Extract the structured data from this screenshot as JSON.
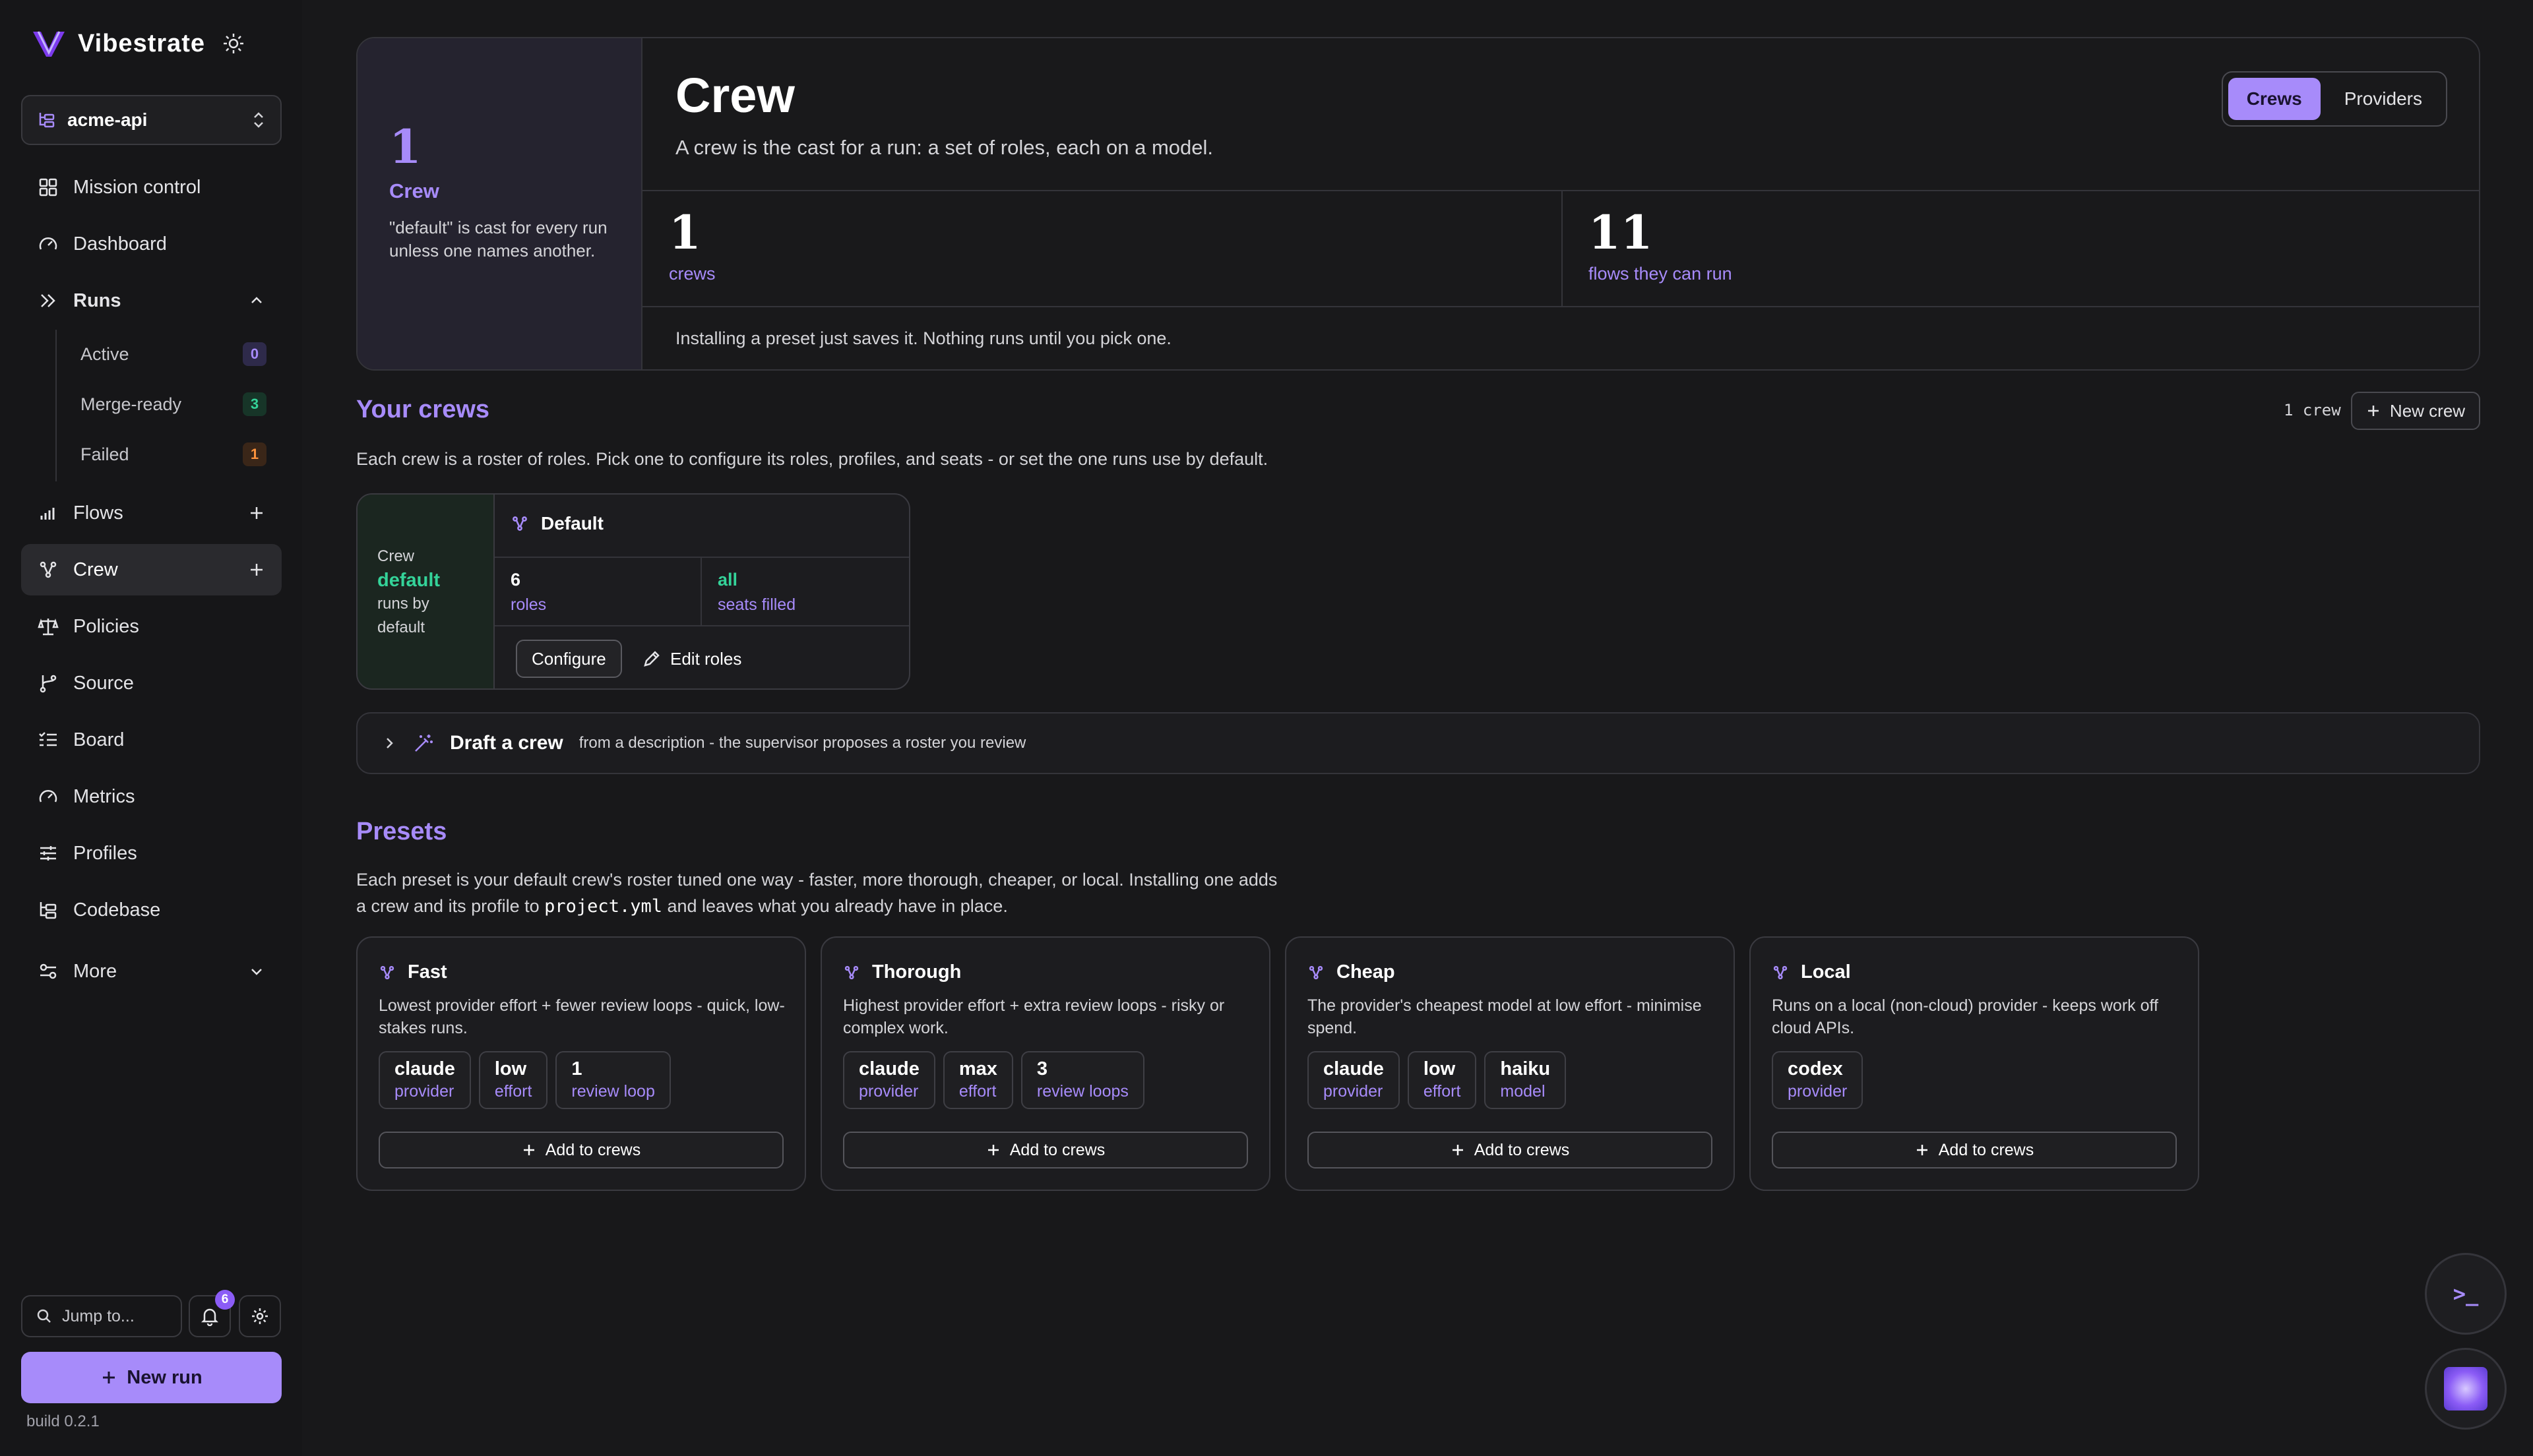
{
  "app": {
    "name": "Vibestrate",
    "build": "build 0.2.1"
  },
  "colors": {
    "accent": "#a78bfa",
    "success": "#34d399",
    "warning": "#fb923c",
    "background": "#18181a"
  },
  "project": {
    "name": "acme-api"
  },
  "sidebar": {
    "items": [
      {
        "label": "Mission control",
        "icon": "grid-icon"
      },
      {
        "label": "Dashboard",
        "icon": "gauge-icon"
      },
      {
        "label": "Runs",
        "icon": "chevrons-right-icon"
      },
      {
        "label": "Flows",
        "icon": "bar-chart-icon"
      },
      {
        "label": "Crew",
        "icon": "nodes-icon"
      },
      {
        "label": "Policies",
        "icon": "scale-icon"
      },
      {
        "label": "Source",
        "icon": "git-branch-icon"
      },
      {
        "label": "Board",
        "icon": "checklist-icon"
      },
      {
        "label": "Metrics",
        "icon": "gauge-icon"
      },
      {
        "label": "Profiles",
        "icon": "sliders-icon"
      },
      {
        "label": "Codebase",
        "icon": "tree-icon"
      },
      {
        "label": "More",
        "icon": "toggles-icon"
      }
    ],
    "runs_sub": [
      {
        "label": "Active",
        "count": "0"
      },
      {
        "label": "Merge-ready",
        "count": "3"
      },
      {
        "label": "Failed",
        "count": "1"
      }
    ],
    "jump_placeholder": "Jump to...",
    "notifications": "6",
    "new_run": "New run"
  },
  "header": {
    "left": {
      "count": "1",
      "label": "Crew",
      "desc": "\"default\" is cast for every run unless one names another."
    },
    "title": "Crew",
    "subtitle": "A crew is the cast for a run: a set of roles, each on a model.",
    "tabs": [
      "Crews",
      "Providers"
    ],
    "stats": [
      {
        "value": "1",
        "label": "crews"
      },
      {
        "value": "11",
        "label": "flows they can run"
      }
    ],
    "footer": "Installing a preset just saves it. Nothing runs until you pick one."
  },
  "your_crews": {
    "title": "Your crews",
    "desc": "Each crew is a roster of roles. Pick one to configure its roles, profiles, and seats - or set the one runs use by default.",
    "count": "1 crew",
    "new_crew": "New crew",
    "card": {
      "tag": "Crew",
      "default_name": "default",
      "note": "runs by default",
      "name": "Default",
      "stats": [
        {
          "value": "6",
          "label": "roles"
        },
        {
          "value": "all",
          "label": "seats filled"
        }
      ],
      "configure": "Configure",
      "edit_roles": "Edit roles"
    }
  },
  "draft": {
    "title": "Draft a crew",
    "desc": "from a description - the supervisor proposes a roster you review"
  },
  "presets": {
    "title": "Presets",
    "desc_a": "Each preset is your default crew's roster tuned one way - faster, more thorough, cheaper, or local. Installing one adds",
    "desc_b": "a crew and its profile to",
    "desc_code": "project.yml",
    "desc_c": "and leaves what you already have in place.",
    "add_label": "Add to crews",
    "items": [
      {
        "name": "Fast",
        "desc": "Lowest provider effort + fewer review loops - quick, low-stakes runs.",
        "chips": [
          {
            "v": "claude",
            "l": "provider"
          },
          {
            "v": "low",
            "l": "effort"
          },
          {
            "v": "1",
            "l": "review loop"
          }
        ]
      },
      {
        "name": "Thorough",
        "desc": "Highest provider effort + extra review loops - risky or complex work.",
        "chips": [
          {
            "v": "claude",
            "l": "provider"
          },
          {
            "v": "max",
            "l": "effort"
          },
          {
            "v": "3",
            "l": "review loops"
          }
        ]
      },
      {
        "name": "Cheap",
        "desc": "The provider's cheapest model at low effort - minimise spend.",
        "chips": [
          {
            "v": "claude",
            "l": "provider"
          },
          {
            "v": "low",
            "l": "effort"
          },
          {
            "v": "haiku",
            "l": "model"
          }
        ]
      },
      {
        "name": "Local",
        "desc": "Runs on a local (non-cloud) provider - keeps work off cloud APIs.",
        "chips": [
          {
            "v": "codex",
            "l": "provider"
          }
        ]
      }
    ]
  },
  "fab": {
    "terminal_prompt": ">_"
  }
}
